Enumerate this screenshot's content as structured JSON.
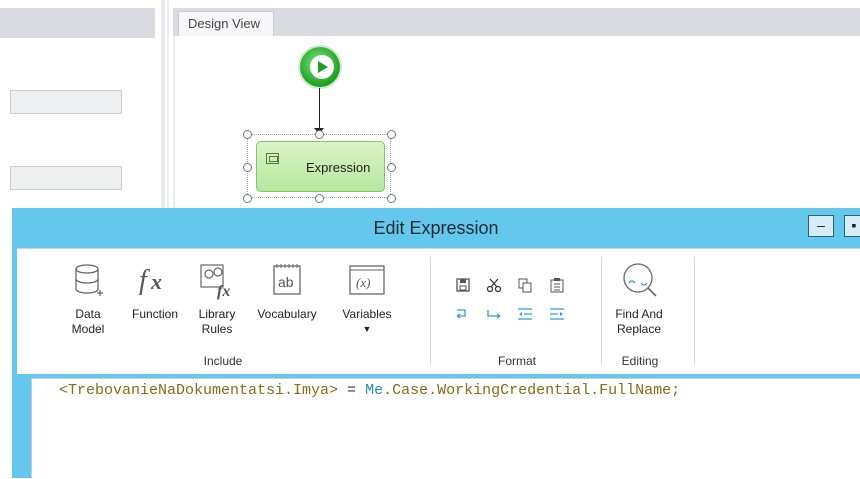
{
  "design_view": {
    "tab_label": "Design View",
    "expression_node_label": "Expression"
  },
  "dialog": {
    "title": "Edit Expression",
    "minimize_label": "–",
    "maximize_label": "▪",
    "ribbon": {
      "include_group": {
        "label": "Include",
        "buttons": [
          {
            "label": "Data\nModel",
            "icon": "database-icon"
          },
          {
            "label": "Function",
            "icon": "function-icon"
          },
          {
            "label": "Library\nRules",
            "icon": "library-rules-icon"
          },
          {
            "label": "Vocabulary",
            "icon": "vocabulary-icon"
          },
          {
            "label": "Variables",
            "icon": "variables-icon"
          }
        ]
      },
      "format_group": {
        "label": "Format",
        "icons": [
          "save-icon",
          "cut-icon",
          "copy-icon",
          "paste-icon",
          "undo-icon",
          "redo-icon",
          "outdent-icon",
          "indent-icon"
        ]
      },
      "editing_group": {
        "label": "Editing",
        "button_label": "Find And\nReplace",
        "icon": "find-replace-icon"
      }
    },
    "code": {
      "field": "<TrebovanieNaDokumentatsi.Imya>",
      "operator": " = ",
      "me": "Me",
      "member": ".Case.WorkingCredential.FullName;"
    }
  },
  "colors": {
    "dialog_title_bar": "#63c8ec",
    "start_node": "#22a822",
    "expression_node": "#c8efb0",
    "code_keyword": "#2b88c9",
    "code_field": "#8a6a14"
  }
}
